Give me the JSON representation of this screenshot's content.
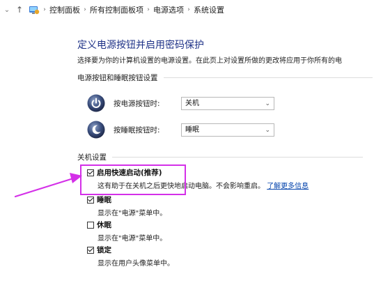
{
  "address_bar": {
    "back_icon": "chevron-down-icon",
    "up_icon": "up-arrow-icon",
    "location_icon": "control-panel-icon",
    "breadcrumbs": [
      "控制面板",
      "所有控制面板项",
      "电源选项",
      "系统设置"
    ],
    "separator": "›"
  },
  "main": {
    "title": "定义电源按钮并启用密码保护",
    "description": "选择要为你的计算机设置的电源设置。在此页上对设置所做的更改将应用于你所有的电",
    "power_section": {
      "header": "电源按钮和睡眠按钮设置",
      "power_button": {
        "label": "按电源按钮时:",
        "value": "关机",
        "icon": "power-icon"
      },
      "sleep_button": {
        "label": "按睡眠按钮时:",
        "value": "睡眠",
        "icon": "sleep-icon"
      }
    },
    "shutdown_section": {
      "header": "关机设置",
      "options": [
        {
          "label": "启用快速启动(推荐)",
          "checked": true,
          "desc": "这有助于在关机之后更快地启动电脑。不会影响重启。",
          "link": "了解更多信息"
        },
        {
          "label": "睡眠",
          "checked": true,
          "desc": "显示在\"电源\"菜单中。"
        },
        {
          "label": "休眠",
          "checked": false,
          "desc": "显示在\"电源\"菜单中。"
        },
        {
          "label": "锁定",
          "checked": true,
          "desc": "显示在用户头像菜单中。"
        }
      ]
    }
  },
  "annotation": {
    "highlight_color": "#d430e8",
    "arrow_color": "#d430e8"
  },
  "colors": {
    "title": "#1e3287",
    "link": "#0645ad",
    "accent_orb": "#2c3e73"
  }
}
